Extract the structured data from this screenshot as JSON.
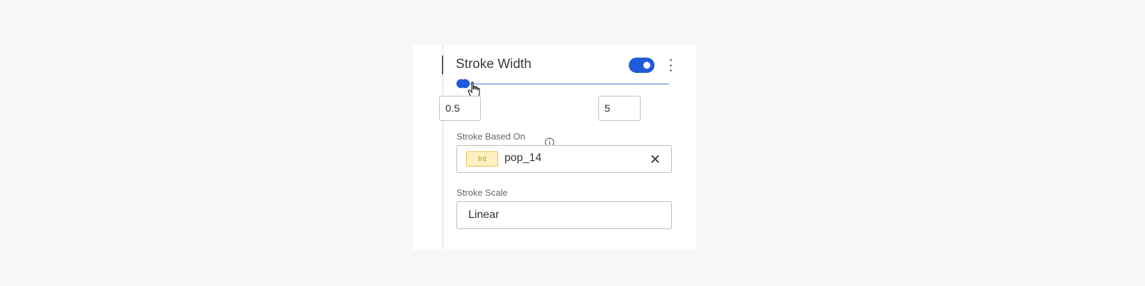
{
  "section": {
    "title": "Stroke Width",
    "enabled": true
  },
  "range": {
    "min_value": "0.5",
    "max_value": "5",
    "selected_fraction_start": 0.0,
    "selected_fraction_end": 0.02
  },
  "stroke_based_on": {
    "label": "Stroke Based On",
    "type_badge": "Int",
    "value": "pop_14"
  },
  "stroke_scale": {
    "label": "Stroke Scale",
    "value": "Linear"
  },
  "colors": {
    "accent": "#1f5bd8",
    "badge_bg": "#fdf0c2",
    "badge_text": "#c79a13"
  }
}
